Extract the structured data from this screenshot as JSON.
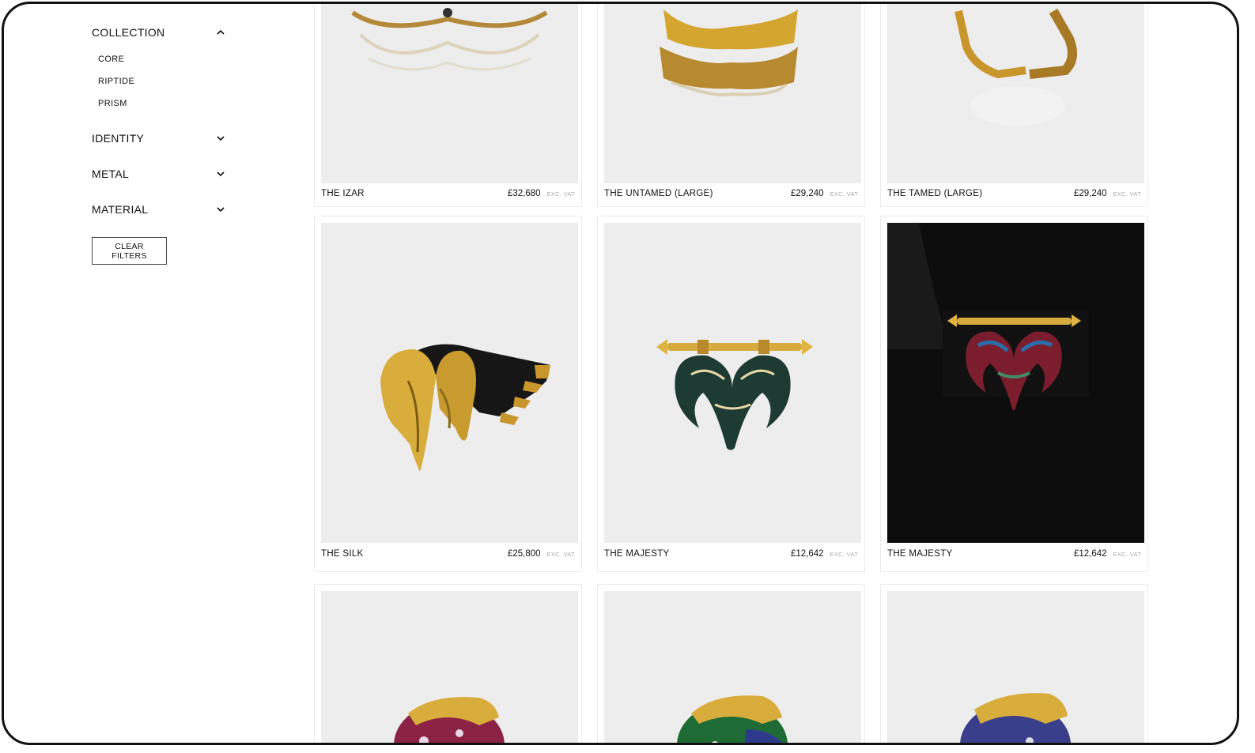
{
  "filters": {
    "collection": {
      "label": "COLLECTION",
      "items": [
        "CORE",
        "RIPTIDE",
        "PRISM"
      ]
    },
    "identity": {
      "label": "IDENTITY"
    },
    "metal": {
      "label": "METAL"
    },
    "material": {
      "label": "MATERIAL"
    },
    "clear_label": "CLEAR FILTERS"
  },
  "vat_label": "EXC. VAT",
  "products": [
    {
      "name": "THE IZAR",
      "price": "£32,680"
    },
    {
      "name": "THE UNTAMED (LARGE)",
      "price": "£29,240"
    },
    {
      "name": "THE TAMED (LARGE)",
      "price": "£29,240"
    },
    {
      "name": "THE SILK",
      "price": "£25,800"
    },
    {
      "name": "THE MAJESTY",
      "price": "£12,642"
    },
    {
      "name": "THE MAJESTY",
      "price": "£12,642"
    }
  ],
  "colors": {
    "gold": "#c9962c",
    "image_bg": "#ededed",
    "dark_bg": "#0c0c0c"
  }
}
